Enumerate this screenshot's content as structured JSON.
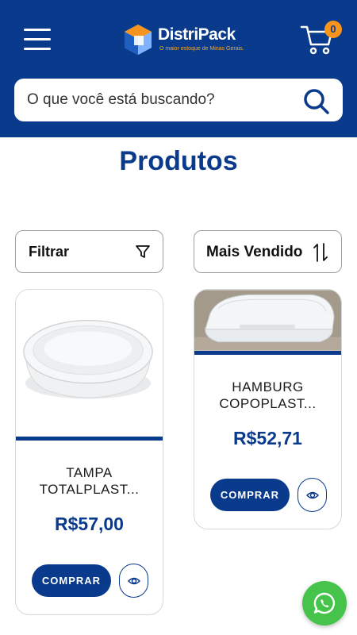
{
  "header": {
    "logo_name": "DistriPack",
    "logo_tagline": "O maior estoque de Minas Gerais.",
    "cart_count": "0",
    "menu_icon": "hamburger-menu-icon",
    "cart_icon": "shopping-cart-icon"
  },
  "search": {
    "placeholder": "O que você está buscando?",
    "icon": "search-icon"
  },
  "page": {
    "title": "Produtos"
  },
  "controls": {
    "filter_label": "Filtrar",
    "filter_icon": "funnel-icon",
    "sort_label": "Mais Vendido",
    "sort_icon": "sort-arrows-icon"
  },
  "products": [
    {
      "name": "TAMPA TOTALPLAST...",
      "price": "R$57,00",
      "buy_label": "COMPRAR",
      "view_icon": "eye-icon"
    },
    {
      "name": "HAMBURG COPOPLAST...",
      "price": "R$52,71",
      "buy_label": "COMPRAR",
      "view_icon": "eye-icon"
    }
  ],
  "floating": {
    "whatsapp_icon": "whatsapp-icon"
  },
  "colors": {
    "brand_blue": "#0a3a8c",
    "accent_orange": "#f7941d",
    "whatsapp_green": "#45c34a"
  }
}
